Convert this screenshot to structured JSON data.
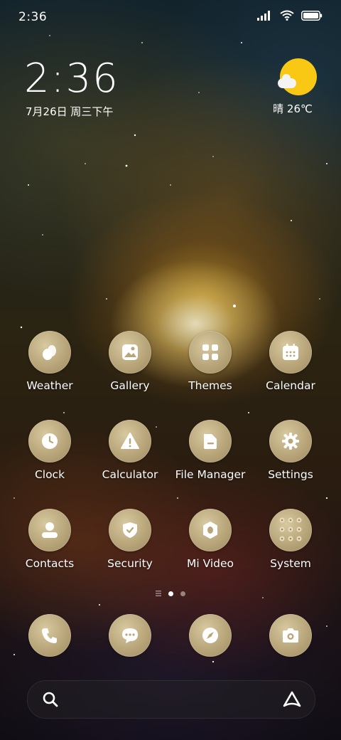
{
  "status_bar": {
    "time": "2:36",
    "icons": [
      "signal-icon",
      "wifi-icon",
      "battery-icon"
    ]
  },
  "clock_widget": {
    "time": "2:36",
    "date": "7月26日 周三下午"
  },
  "weather_widget": {
    "icon": "sunny-partly-cloudy-icon",
    "text": "晴 26℃"
  },
  "apps": [
    {
      "label": "Weather",
      "icon": "weather-drop-icon"
    },
    {
      "label": "Gallery",
      "icon": "gallery-icon"
    },
    {
      "label": "Themes",
      "icon": "themes-grid-icon"
    },
    {
      "label": "Calendar",
      "icon": "calendar-icon"
    },
    {
      "label": "Clock",
      "icon": "clock-icon"
    },
    {
      "label": "Calculator",
      "icon": "warning-triangle-icon"
    },
    {
      "label": "File Manager",
      "icon": "folder-icon"
    },
    {
      "label": "Settings",
      "icon": "gear-icon"
    },
    {
      "label": "Contacts",
      "icon": "contact-person-icon"
    },
    {
      "label": "Security",
      "icon": "shield-check-icon"
    },
    {
      "label": "Mi Video",
      "icon": "video-icon"
    },
    {
      "label": "System",
      "icon": "folder-grid-icon"
    }
  ],
  "page_indicator": {
    "pages": 2,
    "active": 1
  },
  "dock": [
    {
      "icon": "phone-icon"
    },
    {
      "icon": "message-icon"
    },
    {
      "icon": "browser-compass-icon"
    },
    {
      "icon": "camera-icon"
    }
  ],
  "search_bar": {
    "left_icon": "search-icon",
    "right_icon": "assistant-icon"
  },
  "colors": {
    "icon_bg": "#b8a57a",
    "sun": "#f8c814"
  }
}
